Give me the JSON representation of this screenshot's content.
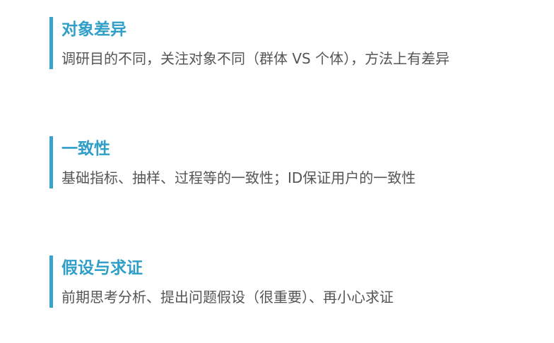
{
  "sections": [
    {
      "title": "对象差异",
      "description": "调研目的不同，关注对象不同（群体 VS 个体），方法上有差异"
    },
    {
      "title": "一致性",
      "description": "基础指标、抽样、过程等的一致性；ID保证用户的一致性"
    },
    {
      "title": "假设与求证",
      "description": "前期思考分析、提出问题假设（很重要）、再小心求证"
    }
  ],
  "colors": {
    "accent": "#2f9fc8",
    "bar": "#3aa3c9",
    "text": "#555555",
    "background": "#ffffff"
  }
}
